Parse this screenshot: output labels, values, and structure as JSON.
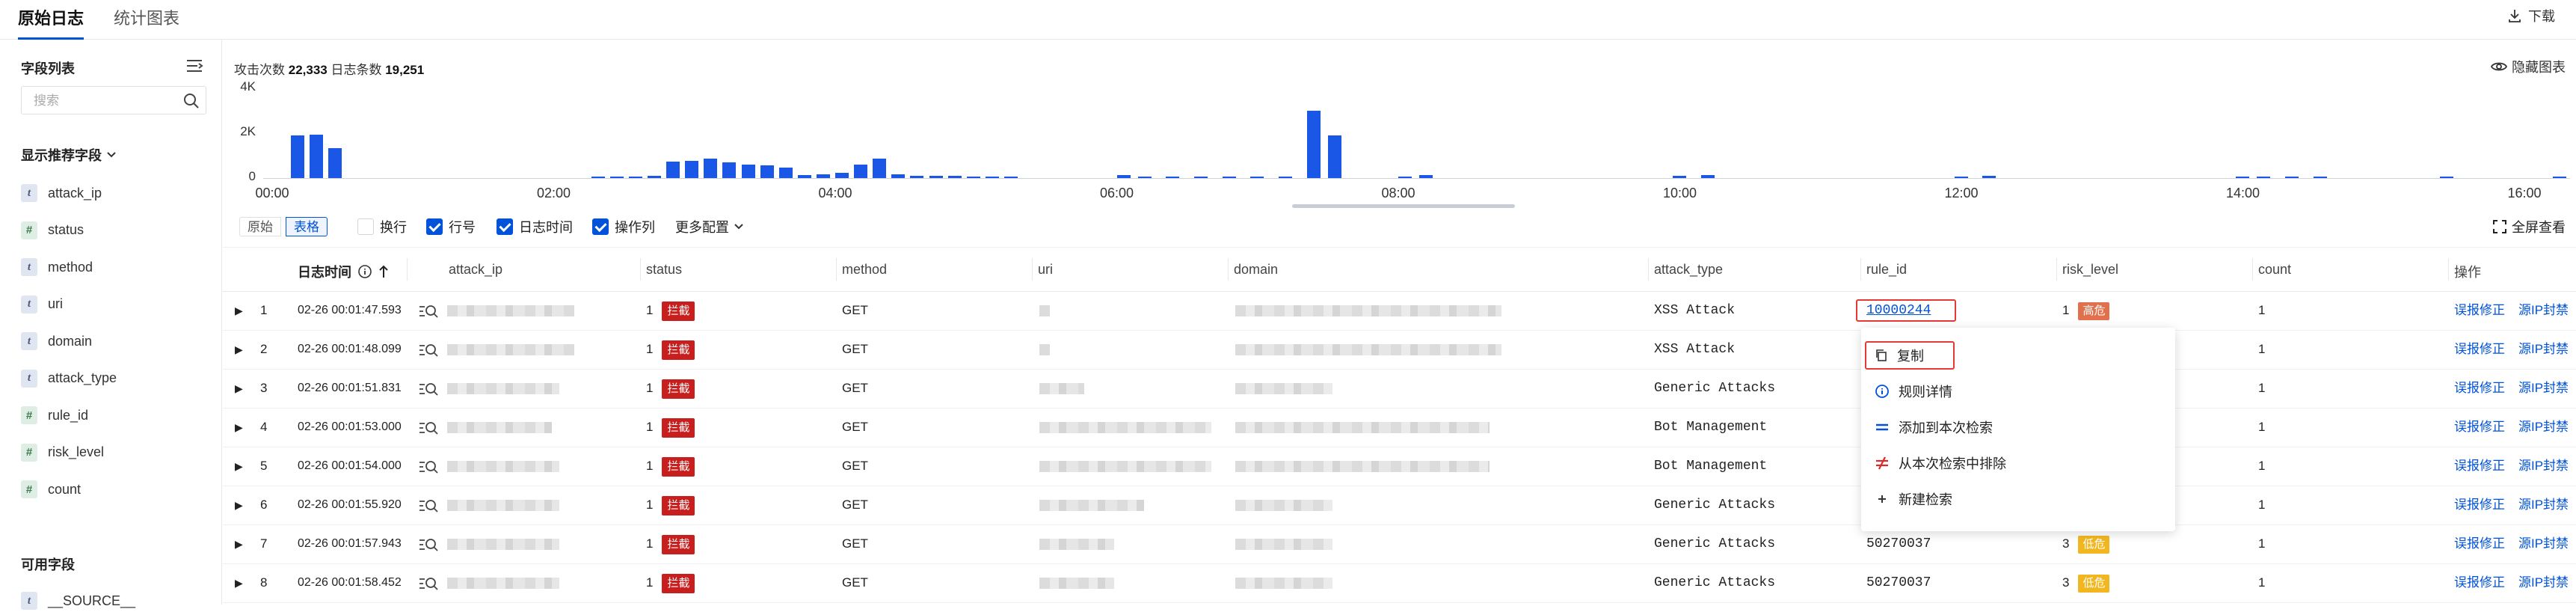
{
  "tabs": [
    {
      "label": "原始日志",
      "active": true
    },
    {
      "label": "统计图表",
      "active": false
    }
  ],
  "download_label": "下载",
  "sidebar": {
    "field_list_title": "字段列表",
    "search_placeholder": "搜索",
    "recommended_title": "显示推荐字段",
    "recommended_fields": [
      {
        "name": "attack_ip",
        "type": "t"
      },
      {
        "name": "status",
        "type": "#"
      },
      {
        "name": "method",
        "type": "t"
      },
      {
        "name": "uri",
        "type": "t"
      },
      {
        "name": "domain",
        "type": "t"
      },
      {
        "name": "attack_type",
        "type": "t"
      },
      {
        "name": "rule_id",
        "type": "#"
      },
      {
        "name": "risk_level",
        "type": "#"
      },
      {
        "name": "count",
        "type": "#"
      }
    ],
    "available_title": "可用字段",
    "available_fields": [
      {
        "name": "__SOURCE__",
        "type": "t"
      }
    ]
  },
  "stats": {
    "attack_label": "攻击次数",
    "attack_count": "22,333",
    "log_label": "日志条数",
    "log_count": "19,251"
  },
  "hide_chart_label": "隐藏图表",
  "histogram": {
    "y_ticks": [
      "4K",
      "2K",
      "0"
    ],
    "y_max": 4000,
    "x_ticks": [
      "00:00",
      "02:00",
      "04:00",
      "06:00",
      "08:00",
      "10:00",
      "12:00",
      "14:00",
      "16:00"
    ],
    "bars": [
      0,
      1900,
      1950,
      1350,
      0,
      0,
      0,
      0,
      0,
      0,
      0,
      0,
      0,
      0,
      0,
      0,
      0,
      30,
      60,
      60,
      90,
      720,
      760,
      880,
      700,
      600,
      560,
      460,
      150,
      160,
      220,
      600,
      860,
      170,
      100,
      100,
      110,
      80,
      70,
      30,
      0,
      0,
      0,
      0,
      0,
      0,
      0,
      0,
      0,
      0,
      0,
      0,
      0,
      0,
      0,
      0,
      0,
      0,
      0,
      0,
      0,
      0,
      0,
      0,
      0,
      0,
      0,
      0,
      0,
      0,
      0,
      0,
      0,
      0,
      0,
      0,
      0,
      0,
      0,
      0,
      0,
      0,
      0,
      0,
      0,
      0,
      0,
      0,
      0,
      0,
      0,
      0,
      0,
      0,
      0,
      0,
      0,
      0,
      0,
      0,
      0,
      0,
      0,
      0,
      0,
      0,
      0,
      0,
      0,
      0,
      0,
      0,
      0,
      0,
      0,
      0,
      0,
      0,
      0,
      0,
      0,
      0,
      0,
      0,
      0,
      0,
      0,
      0,
      0,
      0,
      0,
      0,
      0,
      0,
      0,
      0,
      0,
      0,
      0,
      0,
      0,
      0,
      0,
      0,
      0,
      0,
      0,
      0,
      0,
      0,
      0,
      0,
      0,
      0,
      0,
      0,
      0,
      0,
      0,
      0,
      0,
      0,
      0,
      0,
      0,
      0,
      0,
      0,
      0,
      0,
      0,
      0,
      0,
      0,
      0,
      0,
      0,
      0,
      0,
      0,
      0,
      0,
      0,
      0,
      0,
      0,
      0,
      0,
      0,
      0,
      0,
      0,
      0,
      0,
      0,
      0,
      0,
      0,
      0,
      0,
      0,
      0,
      0,
      0,
      0,
      0,
      0,
      0,
      0,
      0,
      0,
      0,
      0,
      0,
      0,
      0,
      0,
      0,
      0,
      0,
      0,
      0,
      0,
      0,
      0,
      0,
      0,
      0,
      0,
      0,
      0,
      0,
      0,
      0,
      0,
      0,
      0,
      0,
      0,
      0,
      0,
      0,
      0,
      0,
      0,
      0,
      0,
      0,
      0,
      0,
      0,
      0,
      0,
      0,
      0,
      0,
      0,
      0,
      0,
      0,
      0,
      0,
      0,
      0,
      0,
      0,
      0,
      0,
      0,
      0,
      0,
      0,
      0,
      0,
      0,
      0,
      0,
      0,
      0,
      0,
      0,
      0,
      0,
      0,
      0,
      0,
      0,
      0,
      0,
      0,
      0,
      0,
      0,
      0,
      0,
      0,
      0,
      0,
      0,
      0,
      0,
      0,
      0,
      0,
      0,
      0,
      0,
      0,
      0,
      0,
      0,
      0,
      0,
      0,
      0,
      0,
      0,
      0,
      0,
      0,
      0,
      0,
      0,
      0,
      0,
      0,
      0,
      0,
      0,
      0,
      0,
      0,
      0,
      0,
      0,
      0,
      0,
      0,
      0,
      0,
      0,
      0,
      0,
      0,
      0,
      0,
      0,
      0,
      0,
      0,
      0,
      0,
      0,
      0,
      0,
      0,
      0,
      0,
      0,
      0,
      0,
      0,
      0,
      0,
      0,
      0,
      0,
      0,
      0,
      0,
      0,
      0,
      0,
      0,
      0,
      0,
      0
    ],
    "sparse": [
      {
        "hour": 6.0,
        "value": 130
      },
      {
        "hour": 6.15,
        "value": 60
      },
      {
        "hour": 6.35,
        "value": 50
      },
      {
        "hour": 6.55,
        "value": 40
      },
      {
        "hour": 6.75,
        "value": 40
      },
      {
        "hour": 6.95,
        "value": 40
      },
      {
        "hour": 7.15,
        "value": 40
      },
      {
        "hour": 7.35,
        "value": 3000
      },
      {
        "hour": 7.5,
        "value": 1900
      },
      {
        "hour": 8.0,
        "value": 70
      },
      {
        "hour": 8.15,
        "value": 120
      },
      {
        "hour": 9.95,
        "value": 100
      },
      {
        "hour": 10.15,
        "value": 120
      },
      {
        "hour": 11.95,
        "value": 60
      },
      {
        "hour": 12.15,
        "value": 110
      },
      {
        "hour": 13.95,
        "value": 70
      },
      {
        "hour": 14.1,
        "value": 60
      },
      {
        "hour": 14.3,
        "value": 40
      },
      {
        "hour": 14.5,
        "value": 30
      },
      {
        "hour": 15.4,
        "value": 40
      },
      {
        "hour": 16.2,
        "value": 40
      }
    ]
  },
  "toolbar": {
    "view_raw": "原始",
    "view_table": "表格",
    "wrap": "换行",
    "line_no": "行号",
    "log_time": "日志时间",
    "action_col": "操作列",
    "more_config": "更多配置",
    "fullscreen": "全屏查看"
  },
  "table": {
    "columns": [
      "日志时间",
      "attack_ip",
      "status",
      "method",
      "uri",
      "domain",
      "attack_type",
      "rule_id",
      "risk_level",
      "count",
      "操作"
    ],
    "rows": [
      {
        "n": "1",
        "time": "02-26 00:01:47.593",
        "status": "1",
        "status_tag": "拦截",
        "method": "GET",
        "attack_type": "XSS Attack",
        "rule_id": "10000244",
        "risk": "1",
        "risk_tag": "高危",
        "count": "1"
      },
      {
        "n": "2",
        "time": "02-26 00:01:48.099",
        "status": "1",
        "status_tag": "拦截",
        "method": "GET",
        "attack_type": "XSS Attack",
        "rule_id": "",
        "risk": "",
        "risk_tag": "",
        "count": "1"
      },
      {
        "n": "3",
        "time": "02-26 00:01:51.831",
        "status": "1",
        "status_tag": "拦截",
        "method": "GET",
        "attack_type": "Generic Attacks",
        "rule_id": "",
        "risk": "",
        "risk_tag": "",
        "count": "1"
      },
      {
        "n": "4",
        "time": "02-26 00:01:53.000",
        "status": "1",
        "status_tag": "拦截",
        "method": "GET",
        "attack_type": "Bot Management",
        "rule_id": "",
        "risk": "",
        "risk_tag": "",
        "count": "1"
      },
      {
        "n": "5",
        "time": "02-26 00:01:54.000",
        "status": "1",
        "status_tag": "拦截",
        "method": "GET",
        "attack_type": "Bot Management",
        "rule_id": "",
        "risk": "",
        "risk_tag": "",
        "count": "1"
      },
      {
        "n": "6",
        "time": "02-26 00:01:55.920",
        "status": "1",
        "status_tag": "拦截",
        "method": "GET",
        "attack_type": "Generic Attacks",
        "rule_id": "",
        "risk": "",
        "risk_tag": "",
        "count": "1"
      },
      {
        "n": "7",
        "time": "02-26 00:01:57.943",
        "status": "1",
        "status_tag": "拦截",
        "method": "GET",
        "attack_type": "Generic Attacks",
        "rule_id": "50270037",
        "risk": "3",
        "risk_tag": "低危",
        "count": "1"
      },
      {
        "n": "8",
        "time": "02-26 00:01:58.452",
        "status": "1",
        "status_tag": "拦截",
        "method": "GET",
        "attack_type": "Generic Attacks",
        "rule_id": "50270037",
        "risk": "3",
        "risk_tag": "低危",
        "count": "1"
      }
    ],
    "actions": [
      "误报修正",
      "源IP封禁"
    ]
  },
  "context_menu": {
    "items": [
      "复制",
      "规则详情",
      "添加到本次检索",
      "从本次检索中排除",
      "新建检索"
    ]
  },
  "colors": {
    "accent": "#0052d9",
    "bar": "#1a57e6",
    "block_tag": "#c81e1e",
    "high_tag": "#e2704c",
    "low_tag": "#f2b720",
    "highlight": "#e53935"
  }
}
